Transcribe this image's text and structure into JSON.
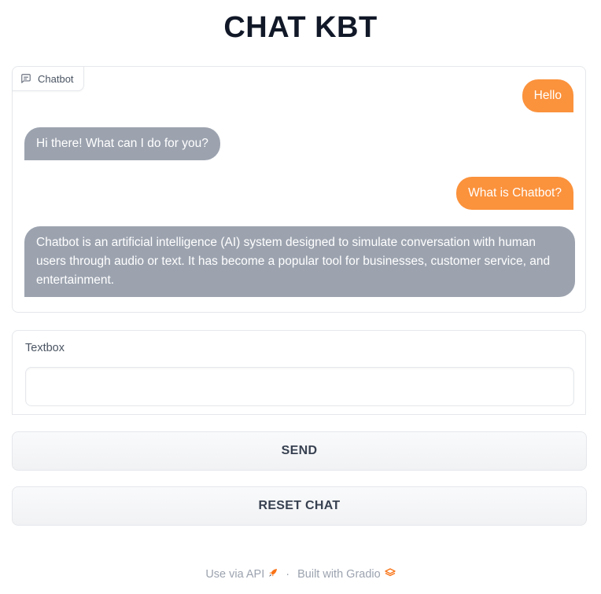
{
  "app": {
    "title": "CHAT KBT"
  },
  "chatbot": {
    "label": "Chatbot",
    "messages": [
      {
        "role": "user",
        "text": "Hello"
      },
      {
        "role": "bot",
        "text": "Hi there! What can I do for you?"
      },
      {
        "role": "user",
        "text": "What is Chatbot?"
      },
      {
        "role": "bot",
        "text": "Chatbot is an artificial intelligence (AI) system designed to simulate conversation with human users through audio or text. It has become a popular tool for businesses, customer service, and entertainment."
      }
    ]
  },
  "textbox": {
    "label": "Textbox",
    "value": "",
    "placeholder": ""
  },
  "buttons": {
    "send": "SEND",
    "reset": "RESET CHAT"
  },
  "footer": {
    "api_link": "Use via API",
    "separator": "·",
    "built_with": "Built with Gradio"
  },
  "colors": {
    "user_bubble": "#fb923c",
    "bot_bubble": "#9ca3af",
    "gradio_logo": "#f97316"
  },
  "icons": {
    "chatbot": "chat-bubble-icon",
    "api": "rocket-icon",
    "gradio": "gradio-logo-icon"
  }
}
